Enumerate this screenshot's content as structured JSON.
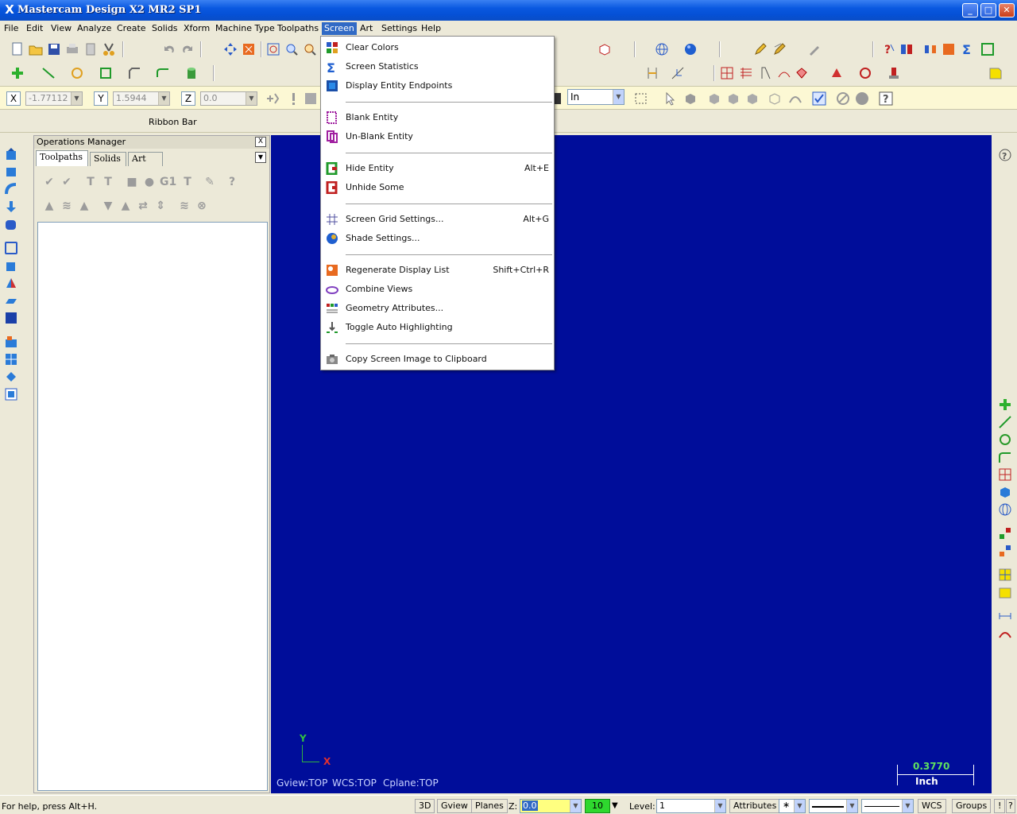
{
  "window": {
    "title": "Mastercam Design X2 MR2 SP1",
    "app_icon": "X",
    "minimize": "_",
    "maximize": "□",
    "close": "✕"
  },
  "menubar": [
    {
      "label": "File"
    },
    {
      "label": "Edit"
    },
    {
      "label": "View"
    },
    {
      "label": "Analyze"
    },
    {
      "label": "Create"
    },
    {
      "label": "Solids"
    },
    {
      "label": "Xform"
    },
    {
      "label": "Machine Type"
    },
    {
      "label": "Toolpaths"
    },
    {
      "label": "Screen"
    },
    {
      "label": "Art"
    },
    {
      "label": "Settings"
    },
    {
      "label": "Help"
    }
  ],
  "ribbon": {
    "x_label": "X",
    "x_value": "-1.77112",
    "y_label": "Y",
    "y_value": "1.5944",
    "z_label": "Z",
    "z_value": "0.0",
    "unit": "In",
    "label": "Ribbon Bar"
  },
  "ops_manager": {
    "title": "Operations Manager",
    "close": "X",
    "tabs": [
      "Toolpaths",
      "Solids",
      "Art"
    ]
  },
  "viewport": {
    "gview": "Gview:TOP",
    "wcs": "WCS:TOP",
    "cplane": "Cplane:TOP",
    "axis_y": "Y",
    "axis_x": "X",
    "scale_value": "0.3770",
    "scale_unit": "Inch",
    "background": "#000d9a"
  },
  "screen_menu": {
    "items": [
      {
        "label": "Clear Colors",
        "shortcut": "",
        "icon": "clear-colors-icon"
      },
      {
        "label": "Screen Statistics",
        "shortcut": "",
        "icon": "sigma-icon"
      },
      {
        "label": "Display Entity Endpoints",
        "shortcut": "",
        "icon": "endpoints-icon"
      },
      {
        "label": "Blank Entity",
        "shortcut": "",
        "icon": "blank-entity-icon"
      },
      {
        "label": "Un-Blank Entity",
        "shortcut": "",
        "icon": "unblank-entity-icon"
      },
      {
        "label": "Hide Entity",
        "shortcut": "Alt+E",
        "icon": "hide-entity-icon"
      },
      {
        "label": "Unhide Some",
        "shortcut": "",
        "icon": "unhide-icon"
      },
      {
        "label": "Screen Grid Settings...",
        "shortcut": "Alt+G",
        "icon": "grid-icon"
      },
      {
        "label": "Shade Settings...",
        "shortcut": "",
        "icon": "shade-sphere-icon"
      },
      {
        "label": "Regenerate Display List",
        "shortcut": "Shift+Ctrl+R",
        "icon": "regenerate-icon"
      },
      {
        "label": "Combine Views",
        "shortcut": "",
        "icon": "combine-views-icon"
      },
      {
        "label": "Geometry Attributes...",
        "shortcut": "",
        "icon": "geometry-attributes-icon"
      },
      {
        "label": "Toggle Auto Highlighting",
        "shortcut": "",
        "icon": "auto-highlight-icon"
      },
      {
        "label": "Copy Screen Image to Clipboard",
        "shortcut": "",
        "icon": "camera-icon"
      }
    ]
  },
  "statusbar": {
    "help": "For help, press Alt+H.",
    "btn_3d": "3D",
    "btn_gview": "Gview",
    "btn_planes": "Planes",
    "z_label": "Z:",
    "z_value": "0.0",
    "color_value": "10",
    "level_label": "Level:",
    "level_value": "1",
    "attributes": "Attributes",
    "wcs": "WCS",
    "groups": "Groups",
    "alert": "!",
    "help_q": "?"
  },
  "colors": {
    "menu_highlight": "#316ac5",
    "viewport": "#000d9a",
    "ribbon": "#fcf8d4",
    "status_green": "#2ed82e"
  }
}
